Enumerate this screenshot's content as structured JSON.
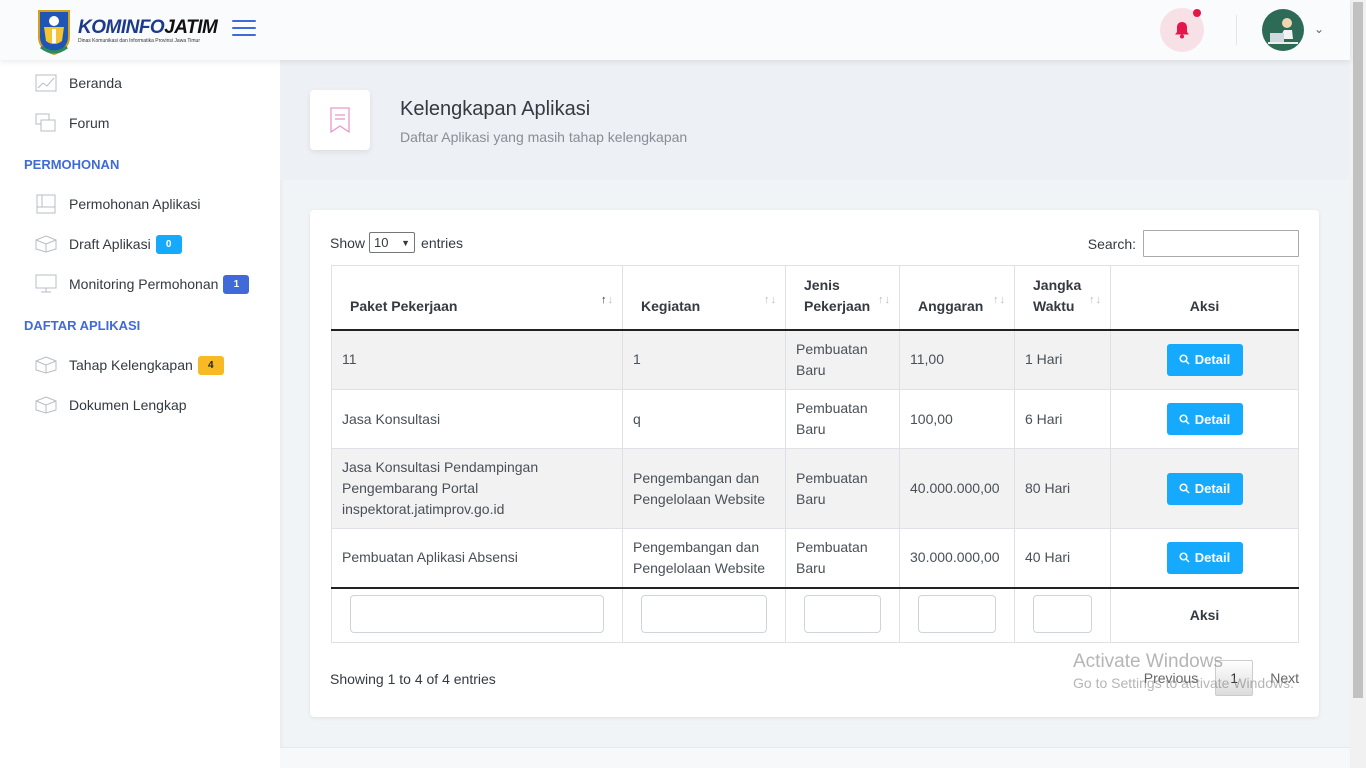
{
  "brand": {
    "name_a": "KOMINFO",
    "name_b": "JATIM",
    "subtitle": "Dinas Komunikasi dan Informatika Provinsi Jawa Timur"
  },
  "colors": {
    "primary": "#3f6ad8",
    "info": "#16aaff",
    "warning": "#f7b924",
    "danger": "#e3174a"
  },
  "sidebar": {
    "items_top": [
      {
        "label": "Beranda",
        "icon": "chart-line-icon"
      },
      {
        "label": "Forum",
        "icon": "chat-bubbles-icon"
      }
    ],
    "section_permohonan": "PERMOHONAN",
    "permohonan": [
      {
        "label": "Permohonan Aplikasi",
        "icon": "document-icon"
      },
      {
        "label": "Draft Aplikasi",
        "icon": "box-icon",
        "badge": "0"
      },
      {
        "label": "Monitoring Permohonan",
        "icon": "monitor-icon",
        "badge": "1"
      }
    ],
    "section_daftar": "DAFTAR APLIKASI",
    "daftar": [
      {
        "label": "Tahap Kelengkapan",
        "icon": "box-icon",
        "badge": "4"
      },
      {
        "label": "Dokumen Lengkap",
        "icon": "box-icon"
      }
    ]
  },
  "page": {
    "title": "Kelengkapan Aplikasi",
    "subtitle": "Daftar Aplikasi yang masih tahap kelengkapan"
  },
  "table": {
    "show_label": "Show",
    "entries_label": "entries",
    "page_length": "10",
    "search_label": "Search:",
    "headers": [
      "Paket Pekerjaan",
      "Kegiatan",
      "Jenis Pekerjaan",
      "Anggaran",
      "Jangka Waktu",
      "Aksi"
    ],
    "rows": [
      {
        "paket": "11",
        "kegiatan": "1",
        "jenis": "Pembuatan Baru",
        "anggaran": "11,00",
        "waktu": "1 Hari",
        "aksi": "Detail"
      },
      {
        "paket": "Jasa Konsultasi",
        "kegiatan": "q",
        "jenis": "Pembuatan Baru",
        "anggaran": "100,00",
        "waktu": "6 Hari",
        "aksi": "Detail"
      },
      {
        "paket": "Jasa Konsultasi Pendampingan Pengembarang Portal inspektorat.jatimprov.go.id",
        "kegiatan": "Pengembangan dan Pengelolaan Website",
        "jenis": "Pembuatan Baru",
        "anggaran": "40.000.000,00",
        "waktu": "80 Hari",
        "aksi": "Detail"
      },
      {
        "paket": "Pembuatan Aplikasi Absensi",
        "kegiatan": "Pengembangan dan Pengelolaan Website",
        "jenis": "Pembuatan Baru",
        "anggaran": "30.000.000,00",
        "waktu": "40 Hari",
        "aksi": "Detail"
      }
    ],
    "footer_aksi": "Aksi",
    "info": "Showing 1 to 4 of 4 entries",
    "pagination": {
      "previous": "Previous",
      "current": "1",
      "next": "Next"
    }
  },
  "watermark": {
    "title": "Activate Windows",
    "subtitle": "Go to Settings to activate Windows."
  }
}
